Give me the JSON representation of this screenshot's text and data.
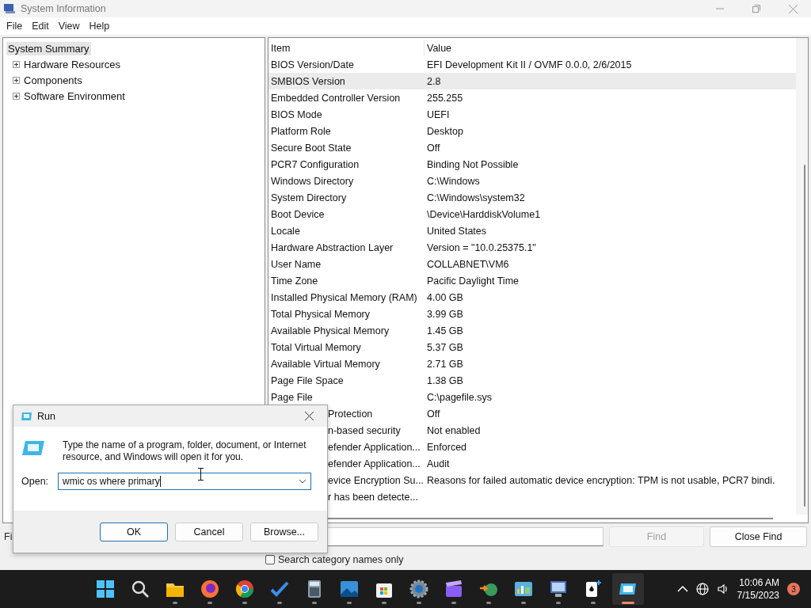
{
  "window": {
    "title": "System Information"
  },
  "menu": [
    "File",
    "Edit",
    "View",
    "Help"
  ],
  "tree": [
    {
      "label": "System Summary",
      "selected": true,
      "children": [
        {
          "label": "Hardware Resources",
          "selected": false,
          "expanded": false
        },
        {
          "label": "Components",
          "selected": false,
          "expanded": false
        },
        {
          "label": "Software Environment",
          "selected": false,
          "expanded": false
        }
      ]
    }
  ],
  "table": {
    "columns": [
      "Item",
      "Value"
    ],
    "rows": [
      {
        "item": "BIOS Version/Date",
        "value": "EFI Development Kit II / OVMF 0.0.0, 2/6/2015",
        "selected": false,
        "partly_hidden": false
      },
      {
        "item": "SMBIOS Version",
        "value": "2.8",
        "selected": true,
        "partly_hidden": false
      },
      {
        "item": "Embedded Controller Version",
        "value": "255.255",
        "selected": false,
        "partly_hidden": false
      },
      {
        "item": "BIOS Mode",
        "value": "UEFI",
        "selected": false,
        "partly_hidden": false
      },
      {
        "item": "Platform Role",
        "value": "Desktop",
        "selected": false,
        "partly_hidden": false
      },
      {
        "item": "Secure Boot State",
        "value": "Off",
        "selected": false,
        "partly_hidden": false
      },
      {
        "item": "PCR7 Configuration",
        "value": "Binding Not Possible",
        "selected": false,
        "partly_hidden": false
      },
      {
        "item": "Windows Directory",
        "value": "C:\\Windows",
        "selected": false,
        "partly_hidden": false
      },
      {
        "item": "System Directory",
        "value": "C:\\Windows\\system32",
        "selected": false,
        "partly_hidden": false
      },
      {
        "item": "Boot Device",
        "value": "\\Device\\HarddiskVolume1",
        "selected": false,
        "partly_hidden": false
      },
      {
        "item": "Locale",
        "value": "United States",
        "selected": false,
        "partly_hidden": false
      },
      {
        "item": "Hardware Abstraction Layer",
        "value": "Version = \"10.0.25375.1\"",
        "selected": false,
        "partly_hidden": false
      },
      {
        "item": "User Name",
        "value": "COLLABNET\\VM6",
        "selected": false,
        "partly_hidden": false
      },
      {
        "item": "Time Zone",
        "value": "Pacific Daylight Time",
        "selected": false,
        "partly_hidden": false
      },
      {
        "item": "Installed Physical Memory (RAM)",
        "value": "4.00 GB",
        "selected": false,
        "partly_hidden": false
      },
      {
        "item": "Total Physical Memory",
        "value": "3.99 GB",
        "selected": false,
        "partly_hidden": false
      },
      {
        "item": "Available Physical Memory",
        "value": "1.45 GB",
        "selected": false,
        "partly_hidden": false
      },
      {
        "item": "Total Virtual Memory",
        "value": "5.37 GB",
        "selected": false,
        "partly_hidden": false
      },
      {
        "item": "Available Virtual Memory",
        "value": "2.71 GB",
        "selected": false,
        "partly_hidden": false
      },
      {
        "item": "Page File Space",
        "value": "1.38 GB",
        "selected": false,
        "partly_hidden": false
      },
      {
        "item": "Page File",
        "value": "C:\\pagefile.sys",
        "selected": false,
        "partly_hidden": false
      },
      {
        "item": "Protection",
        "value": "Off",
        "selected": false,
        "partly_hidden": true
      },
      {
        "item": "n-based security",
        "value": "Not enabled",
        "selected": false,
        "partly_hidden": true
      },
      {
        "item": "efender Application...",
        "value": "Enforced",
        "selected": false,
        "partly_hidden": true
      },
      {
        "item": "efender Application...",
        "value": "Audit",
        "selected": false,
        "partly_hidden": true
      },
      {
        "item": "evice Encryption Su...",
        "value": "Reasons for failed automatic device encryption: TPM is not usable, PCR7 bindi.",
        "selected": false,
        "partly_hidden": true
      },
      {
        "item": "r has been detecte...",
        "value": "",
        "selected": false,
        "partly_hidden": true
      }
    ]
  },
  "find": {
    "label": "Fi",
    "find_button": {
      "label": "Find",
      "disabled": true
    },
    "close_button": {
      "label": "Close Find",
      "disabled": false
    },
    "category_names_only": {
      "label": "Search category names only",
      "checked": false
    }
  },
  "run_dialog": {
    "title": "Run",
    "message": "Type the name of a program, folder, document, or Internet resource, and Windows will open it for you.",
    "open_label": "Open:",
    "value": "wmic os where primary",
    "buttons": [
      {
        "label": "OK",
        "default": true
      },
      {
        "label": "Cancel",
        "default": false
      },
      {
        "label": "Browse...",
        "default": false
      }
    ]
  },
  "taskbar": {
    "apps": [
      {
        "kind": "start",
        "selected": false
      },
      {
        "kind": "search",
        "selected": false
      },
      {
        "kind": "folder",
        "selected": false
      },
      {
        "kind": "orange-browser",
        "selected": false
      },
      {
        "kind": "round-browser",
        "selected": false
      },
      {
        "kind": "check",
        "selected": false
      },
      {
        "kind": "calculator",
        "selected": false
      },
      {
        "kind": "image",
        "selected": false
      },
      {
        "kind": "bag",
        "selected": false
      },
      {
        "kind": "gear",
        "selected": false
      },
      {
        "kind": "clapper",
        "selected": false
      },
      {
        "kind": "network",
        "selected": false
      },
      {
        "kind": "chart",
        "selected": false
      },
      {
        "kind": "monitor",
        "selected": false
      },
      {
        "kind": "cards",
        "selected": false
      },
      {
        "kind": "run",
        "selected": true
      }
    ],
    "time": "10:06 AM",
    "date": "7/15/2023",
    "badge": "3"
  }
}
